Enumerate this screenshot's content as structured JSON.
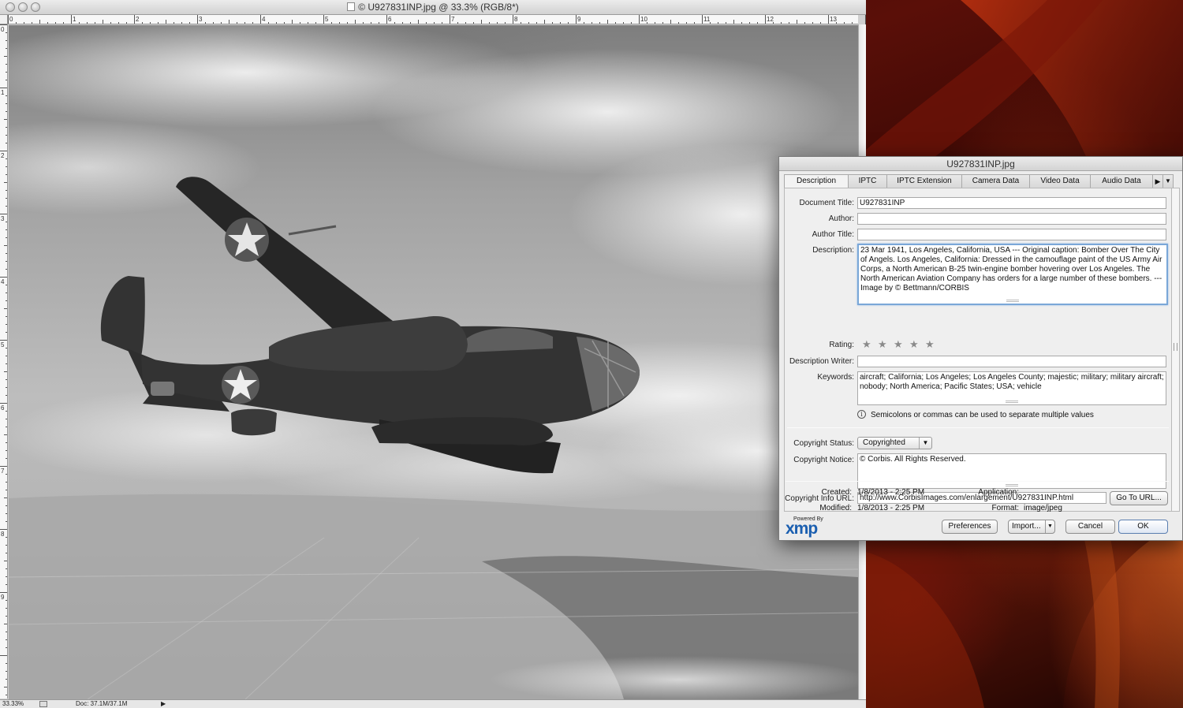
{
  "ps": {
    "title": "© U927831INP.jpg @ 33.3% (RGB/8*)",
    "zoom": "33.33%",
    "doc_size": "Doc: 37.1M/37.1M",
    "ruler_top": [
      "0",
      "1",
      "2",
      "3",
      "4",
      "5",
      "6",
      "7",
      "8",
      "9",
      "10",
      "11",
      "12",
      "13"
    ],
    "ruler_left": [
      "0",
      "1",
      "2",
      "3",
      "4",
      "5",
      "6",
      "7",
      "8",
      "9"
    ]
  },
  "dialog": {
    "title": "U927831INP.jpg",
    "tabs": [
      "Description",
      "IPTC",
      "IPTC Extension",
      "Camera Data",
      "Video Data",
      "Audio Data"
    ],
    "active_tab": "Description",
    "fields": {
      "document_title": {
        "label": "Document Title:",
        "value": "U927831INP"
      },
      "author": {
        "label": "Author:",
        "value": ""
      },
      "author_title": {
        "label": "Author Title:",
        "value": ""
      },
      "description": {
        "label": "Description:",
        "value": "23 Mar 1941, Los Angeles, California, USA --- Original caption: Bomber Over The City of Angels. Los Angeles, California: Dressed in the camouflage paint of the US Army Air Corps, a North American B-25 twin-engine bomber hovering over Los Angeles. The North American Aviation Company has orders for a large number of these bombers. --- Image by © Bettmann/CORBIS"
      },
      "rating": {
        "label": "Rating:",
        "stars": 0,
        "max": 5
      },
      "description_writer": {
        "label": "Description Writer:",
        "value": ""
      },
      "keywords": {
        "label": "Keywords:",
        "value": "aircraft; California; Los Angeles; Los Angeles County; majestic; military; military aircraft; nobody; North America; Pacific States; USA; vehicle"
      },
      "keywords_hint": "Semicolons or commas can be used to separate multiple values",
      "copyright_status": {
        "label": "Copyright Status:",
        "value": "Copyrighted"
      },
      "copyright_notice": {
        "label": "Copyright Notice:",
        "value": "© Corbis.  All Rights Reserved."
      },
      "copyright_url": {
        "label": "Copyright Info URL:",
        "value": "http://www.CorbisImages.com/enlargement/U927831INP.html"
      }
    },
    "go_to_url": "Go To URL...",
    "meta": {
      "created_label": "Created:",
      "created": "1/8/2013 - 2:25 PM",
      "modified_label": "Modified:",
      "modified": "1/8/2013 - 2:25 PM",
      "application_label": "Application:",
      "application": "",
      "format_label": "Format:",
      "format": "image/jpeg"
    },
    "buttons": {
      "preferences": "Preferences",
      "import": "Import...",
      "cancel": "Cancel",
      "ok": "OK"
    },
    "logo": {
      "powered_by": "Powered By",
      "wordmark": "xmp"
    }
  },
  "colors": {
    "accent_blue": "#1b5fb0",
    "focus_ring": "#7aa7d8"
  },
  "icons": [
    "window-close-icon",
    "window-minimize-icon",
    "window-zoom-icon",
    "document-icon",
    "info-icon",
    "tab-scroll-arrow-icon",
    "tab-menu-icon",
    "star-icon",
    "dropdown-caret-icon"
  ]
}
